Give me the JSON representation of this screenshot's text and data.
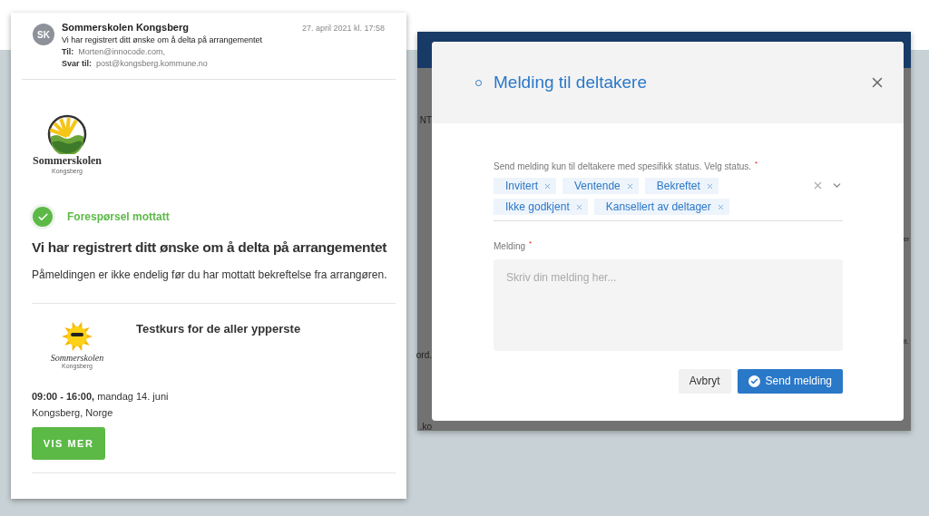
{
  "email": {
    "avatar": "SK",
    "sender": "Sommerskolen Kongsberg",
    "date": "27. april 2021 kl. 17:58",
    "subject": "Vi har registrert ditt ønske om å delta på arrangementet",
    "to": {
      "label": "Til:",
      "value": "Morten@innocode.com,"
    },
    "reply_to": {
      "label": "Svar til:",
      "value": "post@kongsberg.kommune.no"
    },
    "logo": {
      "name": "Sommerskolen",
      "place": "Kongsberg"
    },
    "status": "Forespørsel mottatt",
    "heading": "Vi har registrert ditt ønske om å delta på arrangementet",
    "body": "Påmeldingen er ikke endelig før du har mottatt bekreftelse fra arrangøren.",
    "event": {
      "logo": {
        "name": "Sommerskolen",
        "place": "Kongsberg"
      },
      "title": "Testkurs for de aller ypperste",
      "time": "09:00 - 16:00,",
      "date": "mandag 14. juni",
      "location": "Kongsberg, Norge",
      "button": "VIS MER"
    }
  },
  "background_app": {
    "left_fragments": [
      "NT",
      "ord.",
      ".ko"
    ],
    "right_fragments": [
      "er",
      "it."
    ]
  },
  "modal": {
    "title": "Melding til deltakere",
    "status_field": {
      "label": "Send melding kun til deltakere med spesifikk status. Velg status.",
      "required": true,
      "required_mark": "*",
      "tags": [
        "Invitert",
        "Ventende",
        "Bekreftet",
        "Ikke godkjent",
        "Kansellert av deltager"
      ]
    },
    "message_field": {
      "label": "Melding",
      "required": true,
      "required_mark": "*",
      "placeholder": "Skriv din melding her..."
    },
    "buttons": {
      "cancel": "Avbryt",
      "submit": "Send melding"
    }
  }
}
